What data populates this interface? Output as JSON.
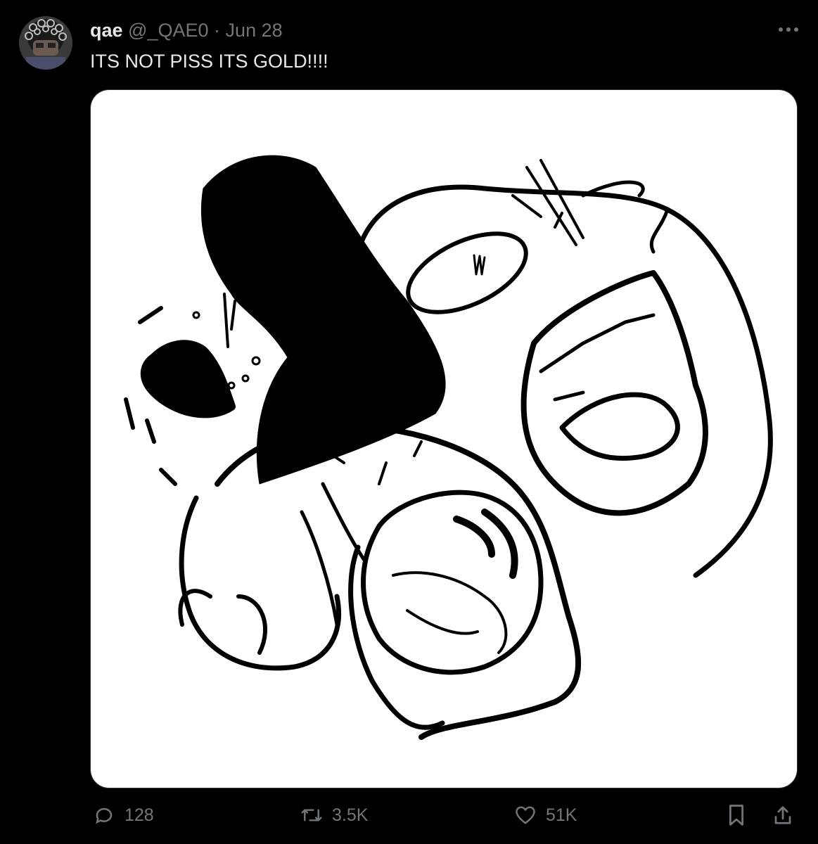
{
  "tweet": {
    "author_name": "qae",
    "handle": "@_QAE0",
    "separator": "·",
    "date": "Jun 28",
    "text": "ITS NOT PISS ITS GOLD!!!!"
  },
  "actions": {
    "replies": "128",
    "reposts": "3.5K",
    "likes": "51K"
  },
  "icons": {
    "more": "more-horizontal-icon",
    "reply": "speech-bubble-icon",
    "repost": "repost-arrows-icon",
    "like": "heart-icon",
    "bookmark": "bookmark-icon",
    "share": "share-upload-icon"
  },
  "colors": {
    "background": "#000000",
    "primary_text": "#e7e9ea",
    "secondary_text": "#71767b",
    "media_background": "#ffffff"
  }
}
